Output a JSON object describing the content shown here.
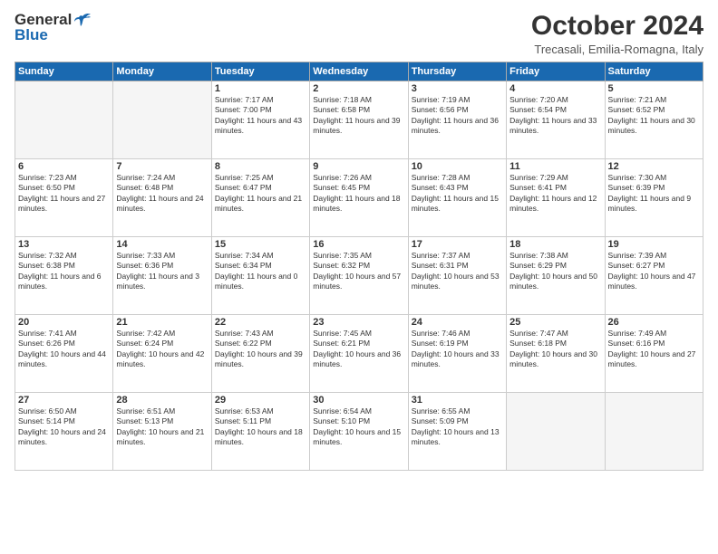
{
  "header": {
    "logo_general": "General",
    "logo_blue": "Blue",
    "month_title": "October 2024",
    "location": "Trecasali, Emilia-Romagna, Italy"
  },
  "weekdays": [
    "Sunday",
    "Monday",
    "Tuesday",
    "Wednesday",
    "Thursday",
    "Friday",
    "Saturday"
  ],
  "weeks": [
    [
      {
        "day": "",
        "empty": true
      },
      {
        "day": "",
        "empty": true
      },
      {
        "day": "1",
        "sunrise": "Sunrise: 7:17 AM",
        "sunset": "Sunset: 7:00 PM",
        "daylight": "Daylight: 11 hours and 43 minutes."
      },
      {
        "day": "2",
        "sunrise": "Sunrise: 7:18 AM",
        "sunset": "Sunset: 6:58 PM",
        "daylight": "Daylight: 11 hours and 39 minutes."
      },
      {
        "day": "3",
        "sunrise": "Sunrise: 7:19 AM",
        "sunset": "Sunset: 6:56 PM",
        "daylight": "Daylight: 11 hours and 36 minutes."
      },
      {
        "day": "4",
        "sunrise": "Sunrise: 7:20 AM",
        "sunset": "Sunset: 6:54 PM",
        "daylight": "Daylight: 11 hours and 33 minutes."
      },
      {
        "day": "5",
        "sunrise": "Sunrise: 7:21 AM",
        "sunset": "Sunset: 6:52 PM",
        "daylight": "Daylight: 11 hours and 30 minutes."
      }
    ],
    [
      {
        "day": "6",
        "sunrise": "Sunrise: 7:23 AM",
        "sunset": "Sunset: 6:50 PM",
        "daylight": "Daylight: 11 hours and 27 minutes."
      },
      {
        "day": "7",
        "sunrise": "Sunrise: 7:24 AM",
        "sunset": "Sunset: 6:48 PM",
        "daylight": "Daylight: 11 hours and 24 minutes."
      },
      {
        "day": "8",
        "sunrise": "Sunrise: 7:25 AM",
        "sunset": "Sunset: 6:47 PM",
        "daylight": "Daylight: 11 hours and 21 minutes."
      },
      {
        "day": "9",
        "sunrise": "Sunrise: 7:26 AM",
        "sunset": "Sunset: 6:45 PM",
        "daylight": "Daylight: 11 hours and 18 minutes."
      },
      {
        "day": "10",
        "sunrise": "Sunrise: 7:28 AM",
        "sunset": "Sunset: 6:43 PM",
        "daylight": "Daylight: 11 hours and 15 minutes."
      },
      {
        "day": "11",
        "sunrise": "Sunrise: 7:29 AM",
        "sunset": "Sunset: 6:41 PM",
        "daylight": "Daylight: 11 hours and 12 minutes."
      },
      {
        "day": "12",
        "sunrise": "Sunrise: 7:30 AM",
        "sunset": "Sunset: 6:39 PM",
        "daylight": "Daylight: 11 hours and 9 minutes."
      }
    ],
    [
      {
        "day": "13",
        "sunrise": "Sunrise: 7:32 AM",
        "sunset": "Sunset: 6:38 PM",
        "daylight": "Daylight: 11 hours and 6 minutes."
      },
      {
        "day": "14",
        "sunrise": "Sunrise: 7:33 AM",
        "sunset": "Sunset: 6:36 PM",
        "daylight": "Daylight: 11 hours and 3 minutes."
      },
      {
        "day": "15",
        "sunrise": "Sunrise: 7:34 AM",
        "sunset": "Sunset: 6:34 PM",
        "daylight": "Daylight: 11 hours and 0 minutes."
      },
      {
        "day": "16",
        "sunrise": "Sunrise: 7:35 AM",
        "sunset": "Sunset: 6:32 PM",
        "daylight": "Daylight: 10 hours and 57 minutes."
      },
      {
        "day": "17",
        "sunrise": "Sunrise: 7:37 AM",
        "sunset": "Sunset: 6:31 PM",
        "daylight": "Daylight: 10 hours and 53 minutes."
      },
      {
        "day": "18",
        "sunrise": "Sunrise: 7:38 AM",
        "sunset": "Sunset: 6:29 PM",
        "daylight": "Daylight: 10 hours and 50 minutes."
      },
      {
        "day": "19",
        "sunrise": "Sunrise: 7:39 AM",
        "sunset": "Sunset: 6:27 PM",
        "daylight": "Daylight: 10 hours and 47 minutes."
      }
    ],
    [
      {
        "day": "20",
        "sunrise": "Sunrise: 7:41 AM",
        "sunset": "Sunset: 6:26 PM",
        "daylight": "Daylight: 10 hours and 44 minutes."
      },
      {
        "day": "21",
        "sunrise": "Sunrise: 7:42 AM",
        "sunset": "Sunset: 6:24 PM",
        "daylight": "Daylight: 10 hours and 42 minutes."
      },
      {
        "day": "22",
        "sunrise": "Sunrise: 7:43 AM",
        "sunset": "Sunset: 6:22 PM",
        "daylight": "Daylight: 10 hours and 39 minutes."
      },
      {
        "day": "23",
        "sunrise": "Sunrise: 7:45 AM",
        "sunset": "Sunset: 6:21 PM",
        "daylight": "Daylight: 10 hours and 36 minutes."
      },
      {
        "day": "24",
        "sunrise": "Sunrise: 7:46 AM",
        "sunset": "Sunset: 6:19 PM",
        "daylight": "Daylight: 10 hours and 33 minutes."
      },
      {
        "day": "25",
        "sunrise": "Sunrise: 7:47 AM",
        "sunset": "Sunset: 6:18 PM",
        "daylight": "Daylight: 10 hours and 30 minutes."
      },
      {
        "day": "26",
        "sunrise": "Sunrise: 7:49 AM",
        "sunset": "Sunset: 6:16 PM",
        "daylight": "Daylight: 10 hours and 27 minutes."
      }
    ],
    [
      {
        "day": "27",
        "sunrise": "Sunrise: 6:50 AM",
        "sunset": "Sunset: 5:14 PM",
        "daylight": "Daylight: 10 hours and 24 minutes."
      },
      {
        "day": "28",
        "sunrise": "Sunrise: 6:51 AM",
        "sunset": "Sunset: 5:13 PM",
        "daylight": "Daylight: 10 hours and 21 minutes."
      },
      {
        "day": "29",
        "sunrise": "Sunrise: 6:53 AM",
        "sunset": "Sunset: 5:11 PM",
        "daylight": "Daylight: 10 hours and 18 minutes."
      },
      {
        "day": "30",
        "sunrise": "Sunrise: 6:54 AM",
        "sunset": "Sunset: 5:10 PM",
        "daylight": "Daylight: 10 hours and 15 minutes."
      },
      {
        "day": "31",
        "sunrise": "Sunrise: 6:55 AM",
        "sunset": "Sunset: 5:09 PM",
        "daylight": "Daylight: 10 hours and 13 minutes."
      },
      {
        "day": "",
        "empty": true
      },
      {
        "day": "",
        "empty": true
      }
    ]
  ]
}
